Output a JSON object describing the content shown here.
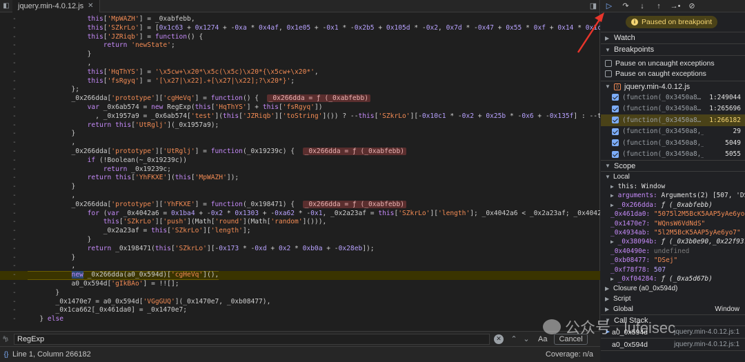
{
  "tab": {
    "filename": "jquery.min-4.0.12.js"
  },
  "code_lines": [
    {
      "g": "-",
      "html": "               <span class='kw'>this</span>[<span class='str'>'MpWAZH'</span>] = _0xabfebb,"
    },
    {
      "g": "-",
      "html": "               <span class='kw'>this</span>[<span class='str'>'SZkrLo'</span>] = [<span class='num'>0x1c63</span> + <span class='num'>0x1274</span> + -<span class='num'>0xa</span> * <span class='num'>0x4af</span>, <span class='num'>0x1e05</span> + -<span class='num'>0x1</span> * -<span class='num'>0x2b5</span> + <span class='num'>0x105d</span> * -<span class='num'>0x2</span>, <span class='num'>0x7d</span> * -<span class='num'>0x47</span> + <span class='num'>0x55</span> * <span class='num'>0xf</span> + <span class='num'>0x14</span> * <span class='num'>0x1c</span>"
    },
    {
      "g": "-",
      "html": "               <span class='kw'>this</span>[<span class='str'>'JZRiqb'</span>] = <span class='kw'>function</span>() {"
    },
    {
      "g": "-",
      "html": "                   <span class='kw'>return</span> <span class='str'>'newState'</span>;"
    },
    {
      "g": "-",
      "html": "               }"
    },
    {
      "g": "-",
      "html": "               ,"
    },
    {
      "g": "-",
      "html": "               <span class='kw'>this</span>[<span class='str'>'HqThYS'</span>] = <span class='str'>'\\x5cw+\\x20*\\x5c(\\x5c)\\x20*{\\x5cw+\\x20*'</span>,"
    },
    {
      "g": "-",
      "html": "               <span class='kw'>this</span>[<span class='str'>'fsRgyq'</span>] = <span class='str'>'[\\x27|\\x22].+[\\x27|\\x22];?\\x20*}'</span>;"
    },
    {
      "g": "-",
      "html": "           };"
    },
    {
      "g": "-",
      "html": "           _0x266dda[<span class='str'>'prototype'</span>][<span class='str'>'cgHeVq'</span>] = <span class='kw'>function</span>() {  <span class='badge'>_0x266dda = ƒ (_0xabfebb)</span>"
    },
    {
      "g": "-",
      "html": "               <span class='kw'>var</span> _0x6ab574 = <span class='kw'>new</span> RegExp(<span class='kw'>this</span>[<span class='str'>'HqThYS'</span>] + <span class='kw'>this</span>[<span class='str'>'fsRgyq'</span>])"
    },
    {
      "g": "-",
      "html": "                 , _0x1957a9 = _0x6ab574[<span class='str'>'test'</span>](<span class='kw'>this</span>[<span class='str'>'JZRiqb'</span>][<span class='str'>'toString'</span>]()) ? --<span class='kw'>this</span>[<span class='str'>'SZkrLo'</span>][-<span class='num'>0x10c1</span> * -<span class='num'>0x2</span> + <span class='num'>0x25b</span> * -<span class='num'>0x6</span> + -<span class='num'>0x135f</span>] : --th"
    },
    {
      "g": "-",
      "html": "               <span class='kw'>return</span> <span class='kw'>this</span>[<span class='str'>'UtRglj'</span>](_0x1957a9);"
    },
    {
      "g": "-",
      "html": "           }"
    },
    {
      "g": "-",
      "html": "           ,"
    },
    {
      "g": "-",
      "html": "           _0x266dda[<span class='str'>'prototype'</span>][<span class='str'>'UtRglj'</span>] = <span class='kw'>function</span>(_0x19239c) {  <span class='badge'>_0x266dda = ƒ (_0xabfebb)</span>"
    },
    {
      "g": "-",
      "html": "               <span class='kw'>if</span> (!Boolean(~_0x19239c))"
    },
    {
      "g": "-",
      "html": "                   <span class='kw'>return</span> _0x19239c;"
    },
    {
      "g": "-",
      "html": "               <span class='kw'>return</span> <span class='kw'>this</span>[<span class='str'>'YhFKXE'</span>](<span class='kw'>this</span>[<span class='str'>'MpWAZH'</span>]);"
    },
    {
      "g": "-",
      "html": "           }"
    },
    {
      "g": "-",
      "html": "           ,"
    },
    {
      "g": "-",
      "html": "           _0x266dda[<span class='str'>'prototype'</span>][<span class='str'>'YhFKXE'</span>] = <span class='kw'>function</span>(_0x198471) {  <span class='badge'>_0x266dda = ƒ (_0xabfebb)</span>"
    },
    {
      "g": "-",
      "html": "               <span class='kw'>for</span> (<span class='kw'>var</span> _0x4042a6 = <span class='num'>0x1ba4</span> + -<span class='num'>0x2</span> * <span class='num'>0x1303</span> + -<span class='num'>0xa62</span> * -<span class='num'>0x1</span>, _0x2a23af = <span class='kw'>this</span>[<span class='str'>'SZkrLo'</span>][<span class='str'>'length'</span>]; _0x4042a6 &lt; _0x2a23af; _0x4042a"
    },
    {
      "g": "-",
      "html": "                   <span class='kw'>this</span>[<span class='str'>'SZkrLo'</span>][<span class='str'>'push'</span>](Math[<span class='str'>'round'</span>](Math[<span class='str'>'random'</span>]())),"
    },
    {
      "g": "-",
      "html": "                   _0x2a23af = <span class='kw'>this</span>[<span class='str'>'SZkrLo'</span>][<span class='str'>'length'</span>];"
    },
    {
      "g": "-",
      "html": "               }"
    },
    {
      "g": "-",
      "html": "               <span class='kw'>return</span> _0x198471(<span class='kw'>this</span>[<span class='str'>'SZkrLo'</span>][-<span class='num'>0x173</span> * -<span class='num'>0xd</span> + <span class='num'>0x2</span> * <span class='num'>0xb0a</span> + -<span class='num'>0x28eb</span>]);"
    },
    {
      "g": "-",
      "html": "           }"
    },
    {
      "g": "-",
      "html": "           ,"
    },
    {
      "g": "-",
      "html": "           <span class='newkw'>new</span> _0x266dda(a0_0x594d)[<span class='str'>'cgHeVq'</span>](),",
      "hl": true
    },
    {
      "g": "-",
      "html": "           a0_0x594d[<span class='str'>'gIkBAo'</span>] = !![];"
    },
    {
      "g": "-",
      "html": "       }"
    },
    {
      "g": "-",
      "html": "       _0x1470e7 = a0_0x594d[<span class='str'>'VGgGUQ'</span>](_0x1470e7, _0xb08477),"
    },
    {
      "g": "-",
      "html": "       _0x1ca662[_0x461da0] = _0x1470e7;"
    },
    {
      "g": "-",
      "html": "   } <span class='kw'>else</span>"
    }
  ],
  "search": {
    "value": "RegExp",
    "aa": "Aa",
    "cancel": "Cancel"
  },
  "status": {
    "position": "Line 1, Column 266182",
    "coverage": "Coverage: n/a"
  },
  "panel": {
    "paused": "Paused on breakpoint",
    "watch": "Watch",
    "breakpoints": "Breakpoints",
    "pause_uncaught": "Pause on uncaught exceptions",
    "pause_caught": "Pause on caught exceptions",
    "bp_file": "jquery.min-4.0.12.js",
    "bps": [
      {
        "t": "(function(_0x3450a8…",
        "ln": "1:249044"
      },
      {
        "t": "(function(_0x3450a8…",
        "ln": "1:265696"
      },
      {
        "t": "(function(_0x3450a8…",
        "ln": "1:266182",
        "cur": true
      },
      {
        "t": "(function(_0x3450a8,_0xaa…",
        "ln": "29"
      },
      {
        "t": "(function(_0x3450a8,_0x…",
        "ln": "5049"
      },
      {
        "t": "(function(_0x3450a8,_0x…",
        "ln": "5055"
      }
    ],
    "scope": "Scope",
    "local": "Local",
    "this_label": "this: Window",
    "args_key": "arguments:",
    "args_val": "Arguments(2) [507, 'DSe",
    "vars": [
      {
        "k": "_0x266dda:",
        "v": "ƒ (_0xabfebb)",
        "c": "vf",
        "arrow": true
      },
      {
        "k": "_0x461da0:",
        "v": "\"5075l2M5BcK5AAP5yAe6yo",
        "c": "vs"
      },
      {
        "k": "_0x1470e7:",
        "v": "\"WQnsW6VdNdS\"",
        "c": "vs"
      },
      {
        "k": "_0x4934ab:",
        "v": "\"5l2M5BcK5AAP5yAe6yo7\"",
        "c": "vs"
      },
      {
        "k": "_0x38094b:",
        "v": "ƒ (_0x3b0e90,_0x22f937)",
        "c": "vf",
        "arrow": true
      },
      {
        "k": "_0x40490e:",
        "v": "undefined",
        "c": "vu"
      },
      {
        "k": "_0xb08477:",
        "v": "\"DSej\"",
        "c": "vs"
      },
      {
        "k": "_0xf78f78:",
        "v": "507",
        "c": "vn"
      },
      {
        "k": "_0xf04284:",
        "v": "ƒ (_0xa5d67b)",
        "c": "vf",
        "arrow": true
      }
    ],
    "closure": "Closure (a0_0x594d)",
    "script": "Script",
    "global": "Global",
    "global_val": "Window",
    "callstack": "Call Stack",
    "frames": [
      {
        "fn": "a0_0x594d",
        "loc": "jquery.min-4.0.12.js:1",
        "cur": true
      },
      {
        "fn": "a0_0x594d",
        "loc": "jquery.min-4.0.12.js:1"
      }
    ]
  },
  "watermark": "公众号 · lufeisec",
  "colors": {
    "accent": "#7cacf8",
    "paused_bg": "#4a4218",
    "paused_fg": "#f7d774",
    "string": "#f28b54",
    "keyword": "#c58af9"
  }
}
